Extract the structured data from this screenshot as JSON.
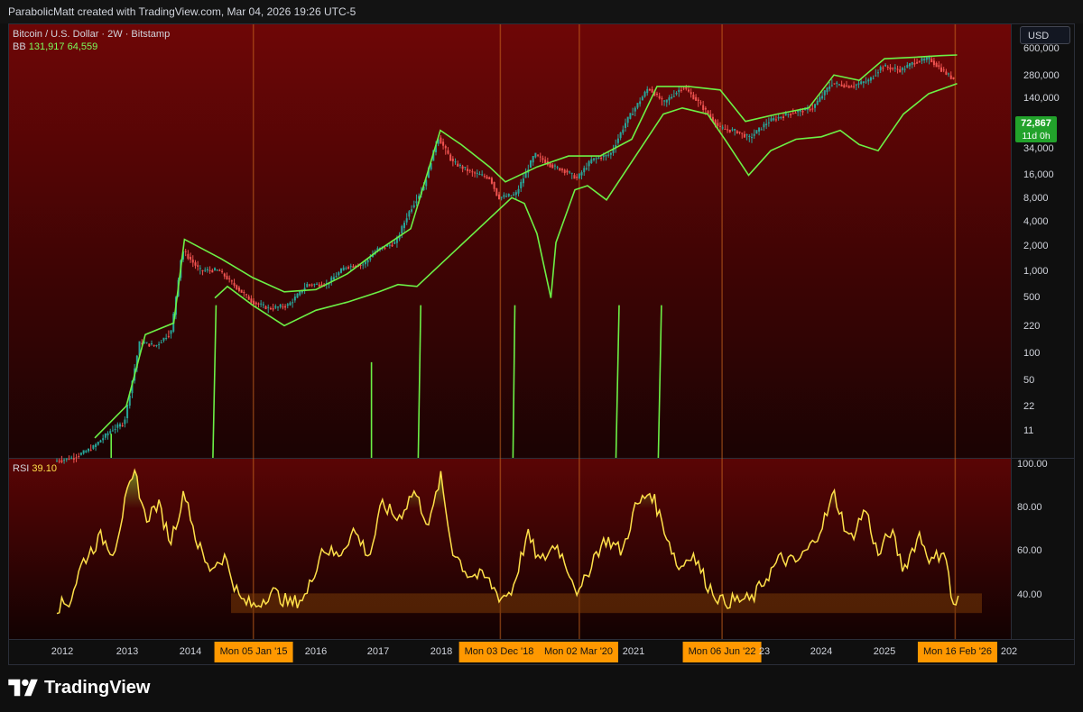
{
  "header": {
    "attribution": "ParabolicMatt created with TradingView.com, Mar 04, 2026 19:26 UTC-5"
  },
  "legend": {
    "symbol": "Bitcoin / U.S. Dollar · 2W · Bitstamp",
    "bb_label": "BB",
    "bb_upper": "131,917",
    "bb_lower": "64,559",
    "rsi_label": "RSI",
    "rsi_value": "39.10"
  },
  "currency_button": "USD",
  "price_tag": {
    "price": "72,867",
    "countdown": "11d 0h"
  },
  "colors": {
    "price_panel_top": "#6e0606",
    "price_panel_bottom": "#1a0303",
    "bb_line": "#6cf046",
    "rsi_line": "#ffe04a",
    "candle_up": "#26a69a",
    "candle_down": "#ef5350",
    "vertical_marker": "#c8641e",
    "date_tag": "#ff9800",
    "zone_band": "#7a3a08"
  },
  "brand": "TradingView",
  "chart_data": [
    {
      "type": "line",
      "title": "Bitcoin / U.S. Dollar · 2W · Bitstamp",
      "y_scale": "log",
      "price_ticks": [
        "600,000",
        "280,000",
        "140,000",
        "72,867",
        "34,000",
        "16,000",
        "8,000",
        "4,000",
        "2,000",
        "1,000",
        "500",
        "220",
        "100",
        "50",
        "22",
        "11"
      ],
      "x_ticks": [
        "2012",
        "2013",
        "2014",
        "Mon 05 Jan '15",
        "2016",
        "2017",
        "2018",
        "Mon 03 Dec '18",
        "Mon 02 Mar '20",
        "2021",
        "Mon 06 Jun '22",
        "23",
        "2024",
        "2025",
        "Mon 16 Feb '26",
        "202"
      ],
      "highlighted_dates": [
        "Mon 05 Jan '15",
        "Mon 03 Dec '18",
        "Mon 02 Mar '20",
        "Mon 06 Jun '22",
        "Mon 16 Feb '26"
      ],
      "series": [
        {
          "name": "Bitcoin / U.S. Dollar",
          "x": [
            2011.9,
            2012.2,
            2012.5,
            2012.8,
            2013.0,
            2013.25,
            2013.5,
            2013.75,
            2013.92,
            2014.2,
            2014.5,
            2014.8,
            2015.04,
            2015.3,
            2015.6,
            2015.9,
            2016.2,
            2016.5,
            2016.8,
            2017.0,
            2017.3,
            2017.5,
            2017.75,
            2017.97,
            2018.2,
            2018.5,
            2018.8,
            2018.92,
            2019.2,
            2019.5,
            2019.8,
            2020.0,
            2020.17,
            2020.4,
            2020.7,
            2020.95,
            2021.3,
            2021.55,
            2021.85,
            2022.1,
            2022.43,
            2022.7,
            2022.9,
            2023.2,
            2023.5,
            2023.9,
            2024.2,
            2024.5,
            2024.8,
            2025.0,
            2025.3,
            2025.5,
            2025.75,
            2025.95,
            2026.12
          ],
          "values": [
            5,
            5.5,
            7,
            11,
            13,
            100,
            90,
            130,
            1000,
            600,
            600,
            380,
            270,
            230,
            250,
            420,
            420,
            650,
            700,
            1000,
            1200,
            2500,
            5000,
            17000,
            9000,
            7000,
            6000,
            3700,
            4000,
            11000,
            8000,
            7200,
            6000,
            9500,
            11000,
            25000,
            58000,
            40000,
            60000,
            40000,
            21000,
            19500,
            16500,
            25000,
            30000,
            35000,
            65000,
            60000,
            70000,
            100000,
            90000,
            110000,
            120000,
            90000,
            72867
          ]
        },
        {
          "name": "BB",
          "x": [
            2012.5,
            2013.0,
            2013.3,
            2013.75,
            2013.92,
            2014.5,
            2015.0,
            2015.5,
            2016.0,
            2016.5,
            2017.0,
            2017.5,
            2017.97,
            2018.3,
            2018.75,
            2019.0,
            2019.5,
            2020.0,
            2020.5,
            2021.0,
            2021.4,
            2021.9,
            2022.4,
            2022.8,
            2023.3,
            2023.8,
            2024.2,
            2024.6,
            2025.0,
            2025.5,
            2025.9,
            2026.15
          ],
          "values": [
            9,
            20,
            120,
            160,
            1300,
            800,
            500,
            350,
            370,
            550,
            1000,
            1700,
            20000,
            14000,
            8000,
            5500,
            8000,
            10500,
            10500,
            16000,
            60000,
            60000,
            55000,
            25000,
            30000,
            35000,
            80000,
            70000,
            120000,
            125000,
            130000,
            131917
          ]
        },
        {
          "name": "BB",
          "x": [
            2014.4,
            2014.6,
            2015.0,
            2015.5,
            2016.0,
            2016.5,
            2017.0,
            2017.3,
            2017.6,
            2019.1,
            2019.3,
            2019.5,
            2019.72,
            2019.8,
            2020.1,
            2020.3,
            2020.6,
            2021.5,
            2021.8,
            2022.2,
            2022.5,
            2022.85,
            2023.2,
            2023.6,
            2024.0,
            2024.3,
            2024.6,
            2024.9,
            2025.3,
            2025.7,
            2026.15
          ],
          "values": [
            300,
            400,
            250,
            150,
            220,
            270,
            350,
            420,
            400,
            3700,
            3200,
            1500,
            300,
            1200,
            4500,
            5000,
            3500,
            30000,
            35000,
            30000,
            15000,
            6500,
            12000,
            16000,
            17000,
            20000,
            14000,
            12000,
            30000,
            50000,
            64559
          ]
        }
      ]
    },
    {
      "type": "line",
      "title": "RSI",
      "ylim": [
        30,
        100
      ],
      "y_ticks": [
        "100.00",
        "80.00",
        "60.00",
        "40.00"
      ],
      "zone": [
        32,
        41
      ],
      "series": [
        {
          "name": "RSI",
          "x": [
            2011.9,
            2012.1,
            2012.3,
            2012.6,
            2012.8,
            2013.0,
            2013.15,
            2013.3,
            2013.5,
            2013.7,
            2013.93,
            2014.1,
            2014.3,
            2014.55,
            2014.8,
            2015.04,
            2015.3,
            2015.6,
            2015.85,
            2016.1,
            2016.35,
            2016.6,
            2016.85,
            2017.05,
            2017.3,
            2017.55,
            2017.8,
            2017.97,
            2018.15,
            2018.4,
            2018.7,
            2018.92,
            2019.1,
            2019.35,
            2019.55,
            2019.8,
            2020.0,
            2020.17,
            2020.4,
            2020.6,
            2020.85,
            2021.05,
            2021.3,
            2021.5,
            2021.75,
            2021.95,
            2022.2,
            2022.43,
            2022.7,
            2022.9,
            2023.1,
            2023.35,
            2023.6,
            2023.85,
            2024.1,
            2024.2,
            2024.45,
            2024.7,
            2024.9,
            2025.1,
            2025.3,
            2025.55,
            2025.75,
            2025.95,
            2026.08,
            2026.2
          ],
          "values": [
            35,
            37,
            55,
            67,
            60,
            85,
            96,
            75,
            82,
            65,
            88,
            66,
            52,
            58,
            38,
            35,
            42,
            36,
            40,
            62,
            58,
            70,
            58,
            82,
            75,
            88,
            72,
            95,
            62,
            50,
            48,
            39,
            42,
            68,
            55,
            64,
            52,
            40,
            58,
            66,
            60,
            80,
            88,
            72,
            52,
            60,
            45,
            37,
            38,
            38,
            47,
            57,
            55,
            63,
            78,
            87,
            65,
            80,
            58,
            70,
            52,
            68,
            55,
            62,
            35,
            39.1
          ]
        }
      ]
    }
  ]
}
